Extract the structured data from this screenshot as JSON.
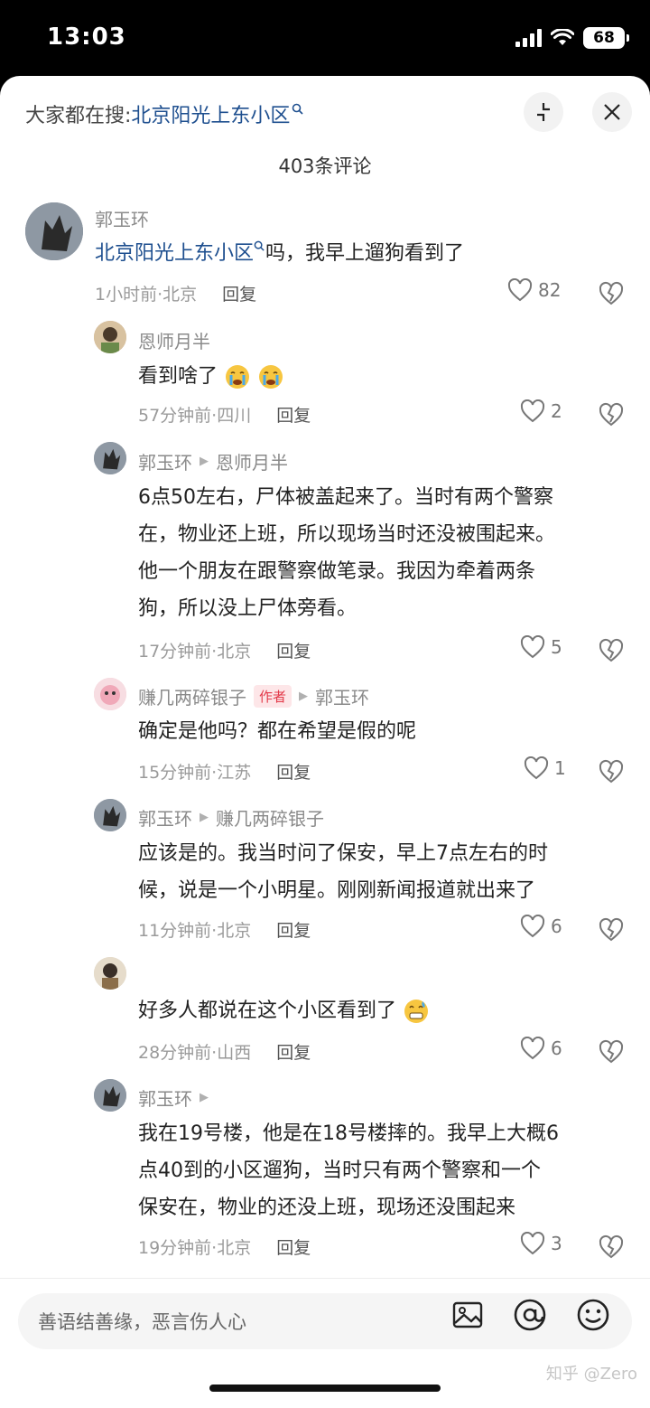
{
  "status": {
    "time": "13:03",
    "battery": "68"
  },
  "header": {
    "search_prefix": "大家都在搜:",
    "search_keyword": "北京阳光上东小区",
    "comment_count": "403条评论"
  },
  "comments": [
    {
      "name": "郭玉环",
      "text_link": "北京阳光上东小区",
      "text": "吗，我早上遛狗看到了",
      "time": "1小时前·北京",
      "reply": "回复",
      "likes": "82"
    },
    {
      "name": "恩师月半",
      "text": "看到啥了",
      "time": "57分钟前·四川",
      "reply": "回复",
      "likes": "2"
    },
    {
      "name": "郭玉环",
      "reply_to": "恩师月半",
      "lines": [
        "6点50左右，尸体被盖起来了。当时有两个警察",
        "在，物业还上班，所以现场当时还没被围起来。",
        "他一个朋友在跟警察做笔录。我因为牵着两条",
        "狗，所以没上尸体旁看。"
      ],
      "time": "17分钟前·北京",
      "reply": "回复",
      "likes": "5"
    },
    {
      "name": "赚几两碎银子",
      "badge": "作者",
      "reply_to": "郭玉环",
      "text": "确定是他吗？都在希望是假的呢",
      "time": "15分钟前·江苏",
      "reply": "回复",
      "likes": "1"
    },
    {
      "name": "郭玉环",
      "reply_to": "赚几两碎银子",
      "lines": [
        "应该是的。我当时问了保安，早上7点左右的时",
        "候，说是一个小明星。刚刚新闻报道就出来了"
      ],
      "time": "11分钟前·北京",
      "reply": "回复",
      "likes": "6"
    },
    {
      "name": "",
      "text": "好多人都说在这个小区看到了",
      "time": "28分钟前·山西",
      "reply": "回复",
      "likes": "6"
    },
    {
      "name": "郭玉环",
      "lines": [
        "我在19号楼，他是在18号楼摔的。我早上大概6",
        "点40到的小区遛狗，当时只有两个警察和一个",
        "保安在，物业的还没上班，现场还没围起来"
      ],
      "time": "19分钟前·北京",
      "reply": "回复",
      "likes": "3"
    }
  ],
  "input": {
    "placeholder": "善语结善缘，恶言伤人心"
  },
  "watermark": "知乎 @Zero"
}
